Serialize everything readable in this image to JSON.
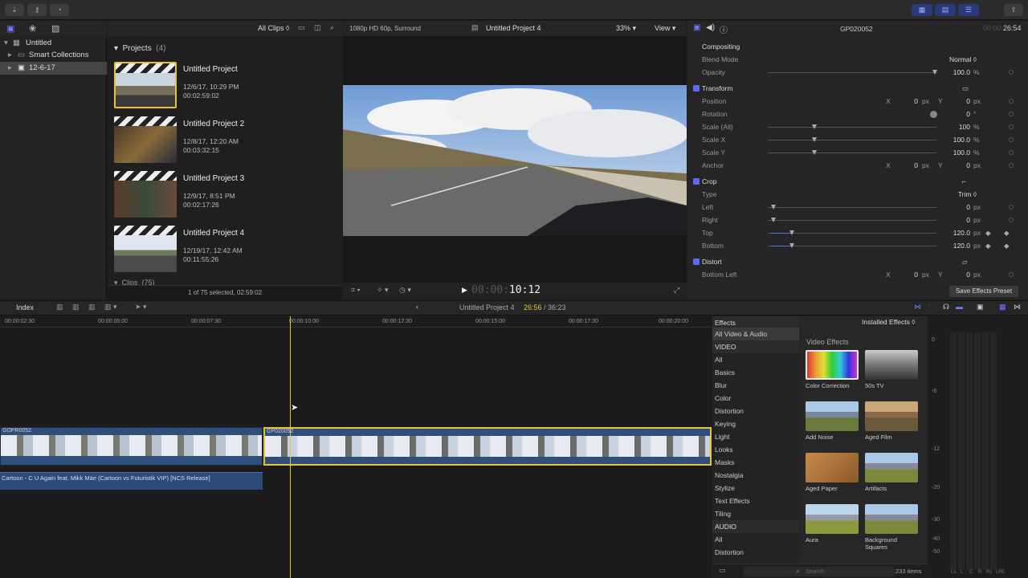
{
  "toolbar": {
    "import_icon": "download-icon",
    "keywords_icon": "key-icon",
    "background_tasks_icon": "clock-icon",
    "layout_buttons": [
      "browser-layout-icon",
      "timeline-layout-icon",
      "inspector-layout-icon"
    ],
    "share_icon": "share-icon"
  },
  "library": {
    "title": "Untitled",
    "items": [
      {
        "label": "Smart Collections"
      },
      {
        "label": "12-6-17"
      }
    ]
  },
  "browser": {
    "filter": "All Clips",
    "section_title": "Projects",
    "section_count": "(4)",
    "projects": [
      {
        "title": "Untitled Project",
        "date": "12/6/17, 10:29 PM",
        "duration": "00:02:59:02"
      },
      {
        "title": "Untitled Project 2",
        "date": "12/8/17, 12:20 AM",
        "duration": "00:03:32:15"
      },
      {
        "title": "Untitled Project 3",
        "date": "12/9/17, 8:51 PM",
        "duration": "00:02:17:26"
      },
      {
        "title": "Untitled Project 4",
        "date": "12/19/17, 12:42 AM",
        "duration": "00:11:55:26"
      }
    ],
    "clips_label": "Clips",
    "clips_count": "(75)",
    "status": "1 of 75 selected, 02:59:02"
  },
  "viewer": {
    "format": "1080p HD 60p, Surround",
    "project": "Untitled Project 4",
    "zoom": "33%",
    "view": "View",
    "timecode_dim": "00:00:",
    "timecode": "10:12"
  },
  "inspector": {
    "clip_name": "GP020052",
    "duration_dim": "00:00:",
    "duration": "26:54",
    "compositing": "Compositing",
    "blend_mode_label": "Blend Mode",
    "blend_mode": "Normal",
    "opacity_label": "Opacity",
    "opacity": "100.0",
    "pct": "%",
    "transform": "Transform",
    "position_label": "Position",
    "rotation_label": "Rotation",
    "scale_all_label": "Scale (All)",
    "scale_x_label": "Scale X",
    "scale_y_label": "Scale Y",
    "anchor_label": "Anchor",
    "x": "X",
    "y": "Y",
    "zero": "0",
    "px": "px",
    "deg": "°",
    "scale_all": "100",
    "scale_x": "100.0",
    "scale_y": "100.0",
    "crop": "Crop",
    "type_label": "Type",
    "type": "Trim",
    "left_label": "Left",
    "right_label": "Right",
    "top_label": "Top",
    "bottom_label": "Bottom",
    "top": "120.0",
    "bottom": "120.0",
    "distort": "Distort",
    "bottom_left_label": "Bottom Left",
    "save_preset": "Save Effects Preset"
  },
  "timeline": {
    "index": "Index",
    "project": "Untitled Project 4",
    "time": "26:56",
    "total": "/ 36:23",
    "ruler": [
      "00:00:02:30",
      "00:00:05:00",
      "00:00:07:30",
      "00:00:10:00",
      "00:00:12:30",
      "00:00:15:00",
      "00:00:17:30",
      "00:00:20:00"
    ],
    "clip1": "GOPR0052",
    "clip2": "GP020052",
    "audio": "Cartoon - C U Again feat. Mikk Mäe (Cartoon vs Futuristik VIP) [NCS Release]"
  },
  "effects": {
    "header": "Effects",
    "installed": "Installed Effects",
    "categories": [
      "All Video & Audio",
      "VIDEO",
      "All",
      "Basics",
      "Blur",
      "Color",
      "Distortion",
      "Keying",
      "Light",
      "Looks",
      "Masks",
      "Nostalgia",
      "Stylize",
      "Text Effects",
      "Tiling",
      "AUDIO",
      "All",
      "Distortion"
    ],
    "section": "Video Effects",
    "items": [
      "Color Correction",
      "50s TV",
      "Add Noise",
      "Aged Film",
      "Aged Paper",
      "Artifacts",
      "Aura",
      "Background Squares"
    ],
    "search_placeholder": "Search",
    "count": "233 items"
  },
  "meters": {
    "scale": [
      "0",
      "-6",
      "-12",
      "-20",
      "-30",
      "-40",
      "-50"
    ],
    "channels": [
      "Ls",
      "L",
      "C",
      "R",
      "Rs",
      "LFE"
    ]
  },
  "colors": {
    "accent": "#5b6cf5",
    "playhead": "#e6c43a",
    "clip": "#2f4f7a"
  }
}
